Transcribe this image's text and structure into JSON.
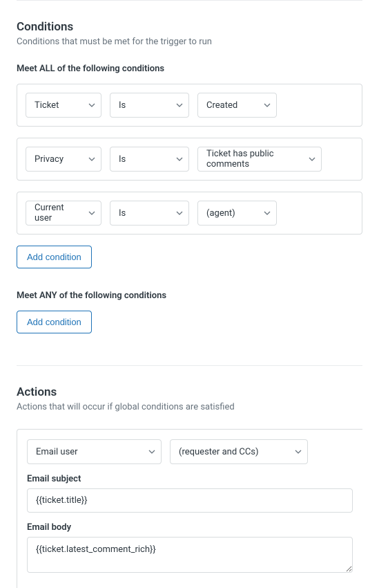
{
  "conditions": {
    "title": "Conditions",
    "subtitle": "Conditions that must be met for the trigger to run",
    "all": {
      "label": "Meet ALL of the following conditions",
      "rows": [
        {
          "field": "Ticket",
          "op": "Is",
          "value": "Created"
        },
        {
          "field": "Privacy",
          "op": "Is",
          "value": "Ticket has public comments"
        },
        {
          "field": "Current user",
          "op": "Is",
          "value": "(agent)"
        }
      ],
      "addLabel": "Add condition"
    },
    "any": {
      "label": "Meet ANY of the following conditions",
      "addLabel": "Add condition"
    }
  },
  "actions": {
    "title": "Actions",
    "subtitle": "Actions that will occur if global conditions are satisfied",
    "row": {
      "action": "Email user",
      "target": "(requester and CCs)"
    },
    "subjectLabel": "Email subject",
    "subjectValue": "{{ticket.title}}",
    "bodyLabel": "Email body",
    "bodyValue": "{{ticket.latest_comment_rich}}"
  }
}
